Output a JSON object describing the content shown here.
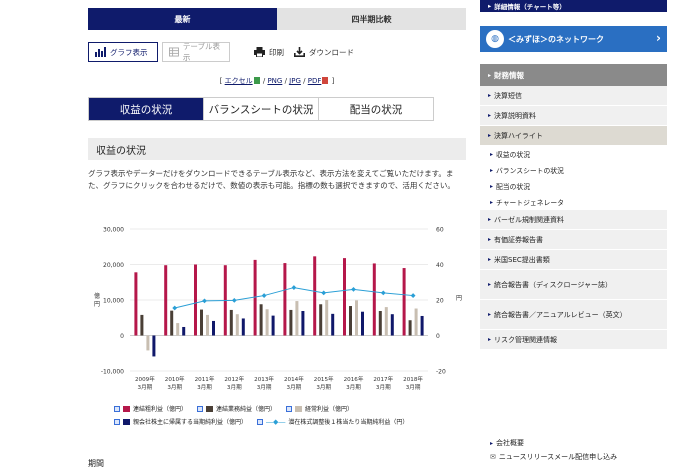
{
  "top_tabs": {
    "latest": "最新",
    "quarterly": "四半期比較"
  },
  "toolbar": {
    "graph": "グラフ表示",
    "table": "テーブル表示",
    "print": "印刷",
    "download": "ダウンロード"
  },
  "formats": {
    "excel": "エクセル",
    "png": "PNG",
    "jpg": "JPG",
    "pdf": "PDF",
    "open": "[",
    "close": "]",
    "sep": "/"
  },
  "tabs": [
    "収益の状況",
    "バランスシートの状況",
    "配当の状況"
  ],
  "section_title": "収益の状況",
  "description": "グラフ表示やデーターだけをダウンロードできるテーブル表示など、表示方法を変えてご覧いただけます。また、グラフにクリックを合わせるだけで、数値の表示も可能。指標の数も選択できますので、活用ください。",
  "chart_data": {
    "type": "bar",
    "categories": [
      "2009年\n3月期",
      "2010年\n3月期",
      "2011年\n3月期",
      "2012年\n3月期",
      "2013年\n3月期",
      "2014年\n3月期",
      "2015年\n3月期",
      "2016年\n3月期",
      "2017年\n3月期",
      "2018年\n3月期"
    ],
    "ylabel_left": "億円",
    "ylabel_right": "円",
    "ylim_left": [
      -10000,
      30000
    ],
    "ylim_right": [
      -20,
      60
    ],
    "left_ticks": [
      "30,000",
      "20,000",
      "10,000",
      "0",
      "-10,000"
    ],
    "right_ticks": [
      "60",
      "40",
      "20",
      "0",
      "-20"
    ],
    "series": [
      {
        "name": "連結粗利益（億円）",
        "color": "#b5174a",
        "axis": "left",
        "values": [
          17800,
          19800,
          20000,
          19800,
          21300,
          20400,
          22300,
          21800,
          20300,
          19000
        ]
      },
      {
        "name": "連結業務純益（億円）",
        "color": "#4a3f36",
        "axis": "left",
        "values": [
          5800,
          7000,
          7300,
          7200,
          8800,
          7200,
          8800,
          8300,
          6900,
          4300
        ]
      },
      {
        "name": "経常利益（億円）",
        "color": "#c8beb1",
        "axis": "left",
        "values": [
          -4200,
          3500,
          5800,
          6000,
          7400,
          9700,
          10000,
          9900,
          8000,
          7600
        ]
      },
      {
        "name": "親会社株主に帰属する当期純利益（億円）",
        "color": "#10186a",
        "axis": "left",
        "values": [
          -5900,
          2400,
          4100,
          4800,
          5600,
          6900,
          6100,
          6700,
          6000,
          5500
        ]
      },
      {
        "name": "潜在株式調整後１株当たり当期純利益（円）",
        "color": "#2a9fd6",
        "axis": "right",
        "type": "line",
        "values": [
          null,
          15.5,
          19.5,
          19.8,
          22.5,
          27.0,
          24.0,
          26.0,
          24.0,
          22.5
        ]
      }
    ],
    "legend": [
      "連結粗利益（億円）",
      "連結業務純益（億円）",
      "経常利益（億円）",
      "親会社株主に帰属する当期純利益（億円）",
      "潜在株式調整後１株当たり当期純利益（円）"
    ],
    "legend_colors": [
      "#b5174a",
      "#4a3f36",
      "#c8beb1",
      "#10186a",
      "#2a9fd6"
    ],
    "grid": true
  },
  "period_label": "期間",
  "sidebar": {
    "top": "詳細情報（チャート等）",
    "mizuho": "＜みずほ＞のネットワーク",
    "head": "財務情報",
    "items": [
      "決算短信",
      "決算説明資料",
      "決算ハイライト"
    ],
    "subitems": [
      "収益の状況",
      "バランスシートの状況",
      "配当の状況",
      "チャートジェネレータ"
    ],
    "items2": [
      "バーゼル規制関連資料",
      "有価証券報告書",
      "米国SEC提出書類",
      "統合報告書（ディスクロージャー誌）",
      "統合報告書／アニュアルレビュー（英文）",
      "リスク管理関連情報"
    ],
    "footer": [
      "会社概要",
      "ニュースリリースメール配信申し込み"
    ]
  }
}
